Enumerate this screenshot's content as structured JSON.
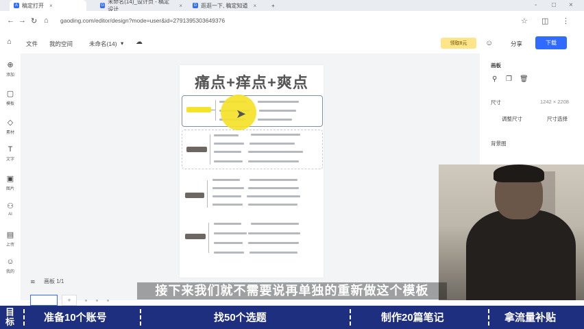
{
  "browser": {
    "tabs": [
      {
        "label": "稿定打开",
        "active": true
      },
      {
        "label": "未命名(14)_设计页 - 稿定设计",
        "active": false
      },
      {
        "label": "逛逛一下, 稿定知道",
        "active": false
      }
    ],
    "new_tab": "+",
    "url": "gaoding.com/editor/design?mode=user&id=27913953036493​76",
    "window_controls": [
      "-",
      "□",
      "×"
    ]
  },
  "toolbar": {
    "home_icon": "home-icon",
    "file": "文件",
    "my_workspace": "我的空间",
    "doc_name": "未命名(14)",
    "dropdown": "▾",
    "vip_label": "领取8元",
    "share": "分享",
    "download": "下载"
  },
  "sidebar": [
    {
      "icon": "⊕",
      "label": "添加"
    },
    {
      "icon": "▢",
      "label": "模板"
    },
    {
      "icon": "◇",
      "label": "素材"
    },
    {
      "icon": "T",
      "label": "文字"
    },
    {
      "icon": "▣",
      "label": "图片"
    },
    {
      "icon": "⚇",
      "label": "AI"
    },
    {
      "icon": "▤",
      "label": "上传"
    },
    {
      "icon": "☺",
      "label": "我的"
    }
  ],
  "canvas": {
    "page_title": "痛点+痒点+爽点",
    "pager_label": "画板 1/1",
    "thumb_add": "+"
  },
  "panel": {
    "heading": "画板",
    "size_label": "尺寸",
    "size_value": "1242 × 2208",
    "size_adjust": "调整尺寸",
    "size_custom": "尺寸选择",
    "bg_label": "背景图"
  },
  "subtitle": "接下来我们就不需要说再单独的重新做这个模板",
  "banner": {
    "target": "目标",
    "step1": "准备10个账号",
    "step2": "找50个选题",
    "step3": "制作20篇笔记",
    "step4": "拿流量补贴"
  }
}
